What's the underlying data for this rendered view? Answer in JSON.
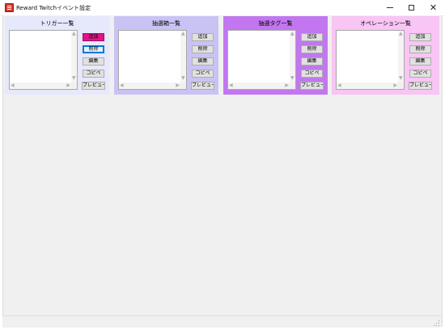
{
  "window": {
    "title": "Reward Twitchイベント設定",
    "icon": "app-icon",
    "controls": {
      "minimize": "minimize-icon",
      "maximize": "maximize-icon",
      "close": "close-icon",
      "close_glyph": "✕"
    }
  },
  "panels": [
    {
      "title": "トリガー一覧",
      "bg": "#e6e8fb",
      "buttons": {
        "add": "追加",
        "delete": "削除",
        "edit": "編集",
        "copy": "コピペ",
        "preview": "プレビュー"
      },
      "add_highlight": "#e0158a",
      "delete_focused": true
    },
    {
      "title": "抽選箱一覧",
      "bg": "#c9c3f4",
      "buttons": {
        "add": "追加",
        "delete": "削除",
        "edit": "編集",
        "copy": "コピペ",
        "preview": "プレビュー"
      }
    },
    {
      "title": "抽選タグ一覧",
      "bg": "#c277f0",
      "buttons": {
        "add": "追加",
        "delete": "削除",
        "edit": "編集",
        "copy": "コピペ",
        "preview": "プレビュー"
      }
    },
    {
      "title": "オペレーション一覧",
      "bg": "#f8c5f4",
      "buttons": {
        "add": "追加",
        "delete": "削除",
        "edit": "編集",
        "copy": "コピペ",
        "preview": "プレビュー"
      }
    }
  ],
  "scroll_arrows": {
    "up": "▲",
    "down": "▼",
    "left": "◀",
    "right": "▶"
  }
}
